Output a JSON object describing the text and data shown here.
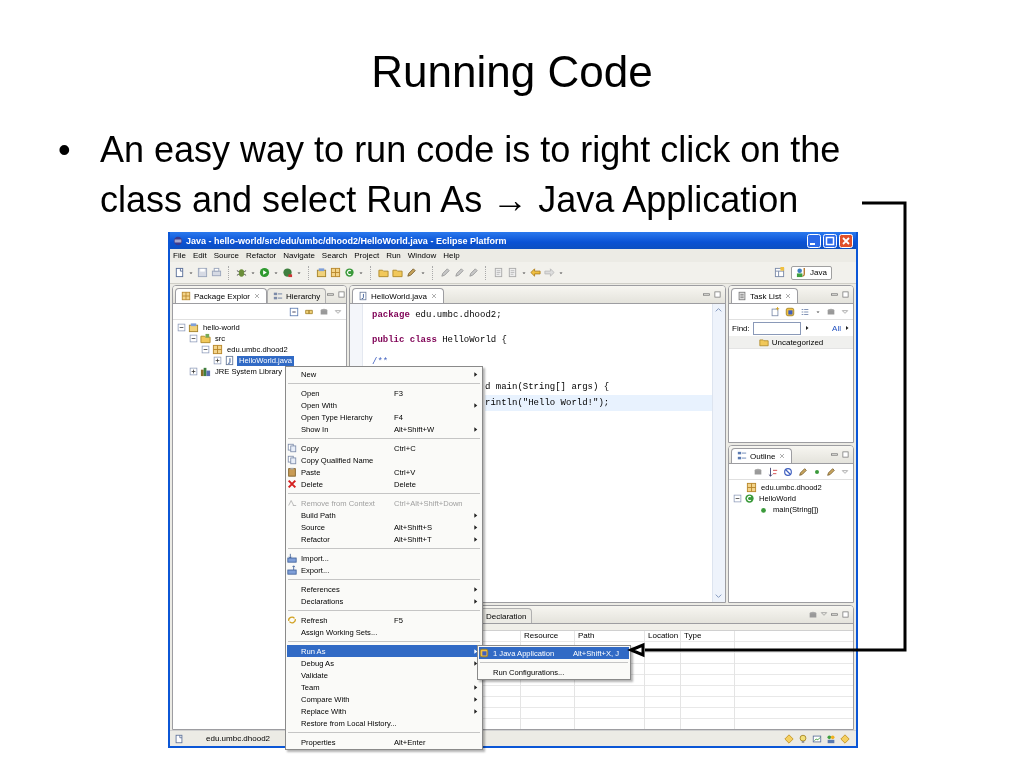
{
  "slide": {
    "title": "Running Code",
    "bullet": "•",
    "text": "An easy way to run code is to right click on the class and select Run As → Java Application"
  },
  "window": {
    "title": "Java - hello-world/src/edu/umbc/dhood2/HelloWorld.java - Eclipse Platform",
    "menu_bar": [
      "File",
      "Edit",
      "Source",
      "Refactor",
      "Navigate",
      "Search",
      "Project",
      "Run",
      "Window",
      "Help"
    ],
    "perspective": "Java"
  },
  "package_explorer": {
    "tabs": [
      {
        "label": "Package Explor",
        "selected": true
      },
      {
        "label": "Hierarchy",
        "selected": false
      }
    ],
    "tree": [
      {
        "label": "hello-world",
        "kind": "project",
        "expanded": true,
        "selected": false,
        "children": [
          {
            "label": "src",
            "kind": "source-folder",
            "expanded": true,
            "selected": false,
            "children": [
              {
                "label": "edu.umbc.dhood2",
                "kind": "package",
                "expanded": true,
                "selected": false,
                "children": [
                  {
                    "label": "HelloWorld.java",
                    "kind": "file",
                    "expanded": false,
                    "selected": true
                  }
                ]
              }
            ]
          },
          {
            "label": "JRE System Library",
            "kind": "library",
            "expanded": false,
            "selected": false
          }
        ]
      }
    ]
  },
  "editor": {
    "tab": "HelloWorld.java",
    "lines": [
      {
        "text": "**package** edu.umbc.dhood2;",
        "kind": "code",
        "current": false
      },
      {
        "text": "**public class** HelloWorld {",
        "kind": "code",
        "current": false
      },
      {
        "text": "/**",
        "kind": "comment",
        "current": false
      },
      {
        "text": "d main(String[] args) {",
        "kind": "covered",
        "current": false
      },
      {
        "text": "rintln(\"Hello World!\");",
        "kind": "covered",
        "current": true
      }
    ]
  },
  "task_list": {
    "title": "Task List",
    "find_label": "Find:",
    "filter": "All",
    "category": "Uncategorized"
  },
  "outline": {
    "title": "Outline",
    "tree": [
      {
        "label": "edu.umbc.dhood2",
        "kind": "package"
      },
      {
        "label": "HelloWorld",
        "kind": "class",
        "expanded": true,
        "children": [
          {
            "label": "main(String[])",
            "kind": "method"
          }
        ]
      }
    ]
  },
  "bottom_panel": {
    "tab": "Declaration",
    "columns": [
      "Resource",
      "Path",
      "Location",
      "Type"
    ]
  },
  "status_bar": {
    "text": "edu.umbc.dhood2"
  },
  "context_menu": {
    "items": [
      {
        "kind": "item",
        "label": "New",
        "submenu": true,
        "disabled": false,
        "selected": false
      },
      {
        "kind": "separator"
      },
      {
        "kind": "item",
        "label": "Open",
        "shortcut": "F3",
        "submenu": false,
        "disabled": false,
        "selected": false
      },
      {
        "kind": "item",
        "label": "Open With",
        "submenu": true,
        "disabled": false,
        "selected": false
      },
      {
        "kind": "item",
        "label": "Open Type Hierarchy",
        "shortcut": "F4",
        "submenu": false,
        "disabled": false,
        "selected": false
      },
      {
        "kind": "item",
        "label": "Show In",
        "shortcut": "Alt+Shift+W",
        "submenu": true,
        "disabled": false,
        "selected": false
      },
      {
        "kind": "separator"
      },
      {
        "kind": "item",
        "label": "Copy",
        "shortcut": "Ctrl+C",
        "submenu": false,
        "disabled": false,
        "selected": false
      },
      {
        "kind": "item",
        "label": "Copy Qualified Name",
        "submenu": false,
        "disabled": false,
        "selected": false
      },
      {
        "kind": "item",
        "label": "Paste",
        "shortcut": "Ctrl+V",
        "submenu": false,
        "disabled": false,
        "selected": false
      },
      {
        "kind": "item",
        "label": "Delete",
        "shortcut": "Delete",
        "submenu": false,
        "disabled": false,
        "selected": false
      },
      {
        "kind": "separator"
      },
      {
        "kind": "item",
        "label": "Remove from Context",
        "shortcut": "Ctrl+Alt+Shift+Down",
        "submenu": false,
        "disabled": true,
        "selected": false
      },
      {
        "kind": "item",
        "label": "Build Path",
        "submenu": true,
        "disabled": false,
        "selected": false
      },
      {
        "kind": "item",
        "label": "Source",
        "shortcut": "Alt+Shift+S",
        "submenu": true,
        "disabled": false,
        "selected": false
      },
      {
        "kind": "item",
        "label": "Refactor",
        "shortcut": "Alt+Shift+T",
        "submenu": true,
        "disabled": false,
        "selected": false
      },
      {
        "kind": "separator"
      },
      {
        "kind": "item",
        "label": "Import...",
        "submenu": false,
        "disabled": false,
        "selected": false
      },
      {
        "kind": "item",
        "label": "Export...",
        "submenu": false,
        "disabled": false,
        "selected": false
      },
      {
        "kind": "separator"
      },
      {
        "kind": "item",
        "label": "References",
        "submenu": true,
        "disabled": false,
        "selected": false
      },
      {
        "kind": "item",
        "label": "Declarations",
        "submenu": true,
        "disabled": false,
        "selected": false
      },
      {
        "kind": "separator"
      },
      {
        "kind": "item",
        "label": "Refresh",
        "shortcut": "F5",
        "submenu": false,
        "disabled": false,
        "selected": false
      },
      {
        "kind": "item",
        "label": "Assign Working Sets...",
        "submenu": false,
        "disabled": false,
        "selected": false
      },
      {
        "kind": "separator"
      },
      {
        "kind": "item",
        "label": "Run As",
        "submenu": true,
        "disabled": false,
        "selected": true
      },
      {
        "kind": "item",
        "label": "Debug As",
        "submenu": true,
        "disabled": false,
        "selected": false
      },
      {
        "kind": "item",
        "label": "Validate",
        "submenu": false,
        "disabled": false,
        "selected": false
      },
      {
        "kind": "item",
        "label": "Team",
        "submenu": true,
        "disabled": false,
        "selected": false
      },
      {
        "kind": "item",
        "label": "Compare With",
        "submenu": true,
        "disabled": false,
        "selected": false
      },
      {
        "kind": "item",
        "label": "Replace With",
        "submenu": true,
        "disabled": false,
        "selected": false
      },
      {
        "kind": "item",
        "label": "Restore from Local History...",
        "submenu": false,
        "disabled": false,
        "selected": false
      },
      {
        "kind": "separator"
      },
      {
        "kind": "item",
        "label": "Properties",
        "shortcut": "Alt+Enter",
        "submenu": false,
        "disabled": false,
        "selected": false
      }
    ]
  },
  "submenu": {
    "items": [
      {
        "kind": "item",
        "label": "1 Java Application",
        "shortcut": "Alt+Shift+X, J",
        "selected": true
      },
      {
        "kind": "separator"
      },
      {
        "kind": "item",
        "label": "Run Configurations...",
        "selected": false
      }
    ]
  }
}
